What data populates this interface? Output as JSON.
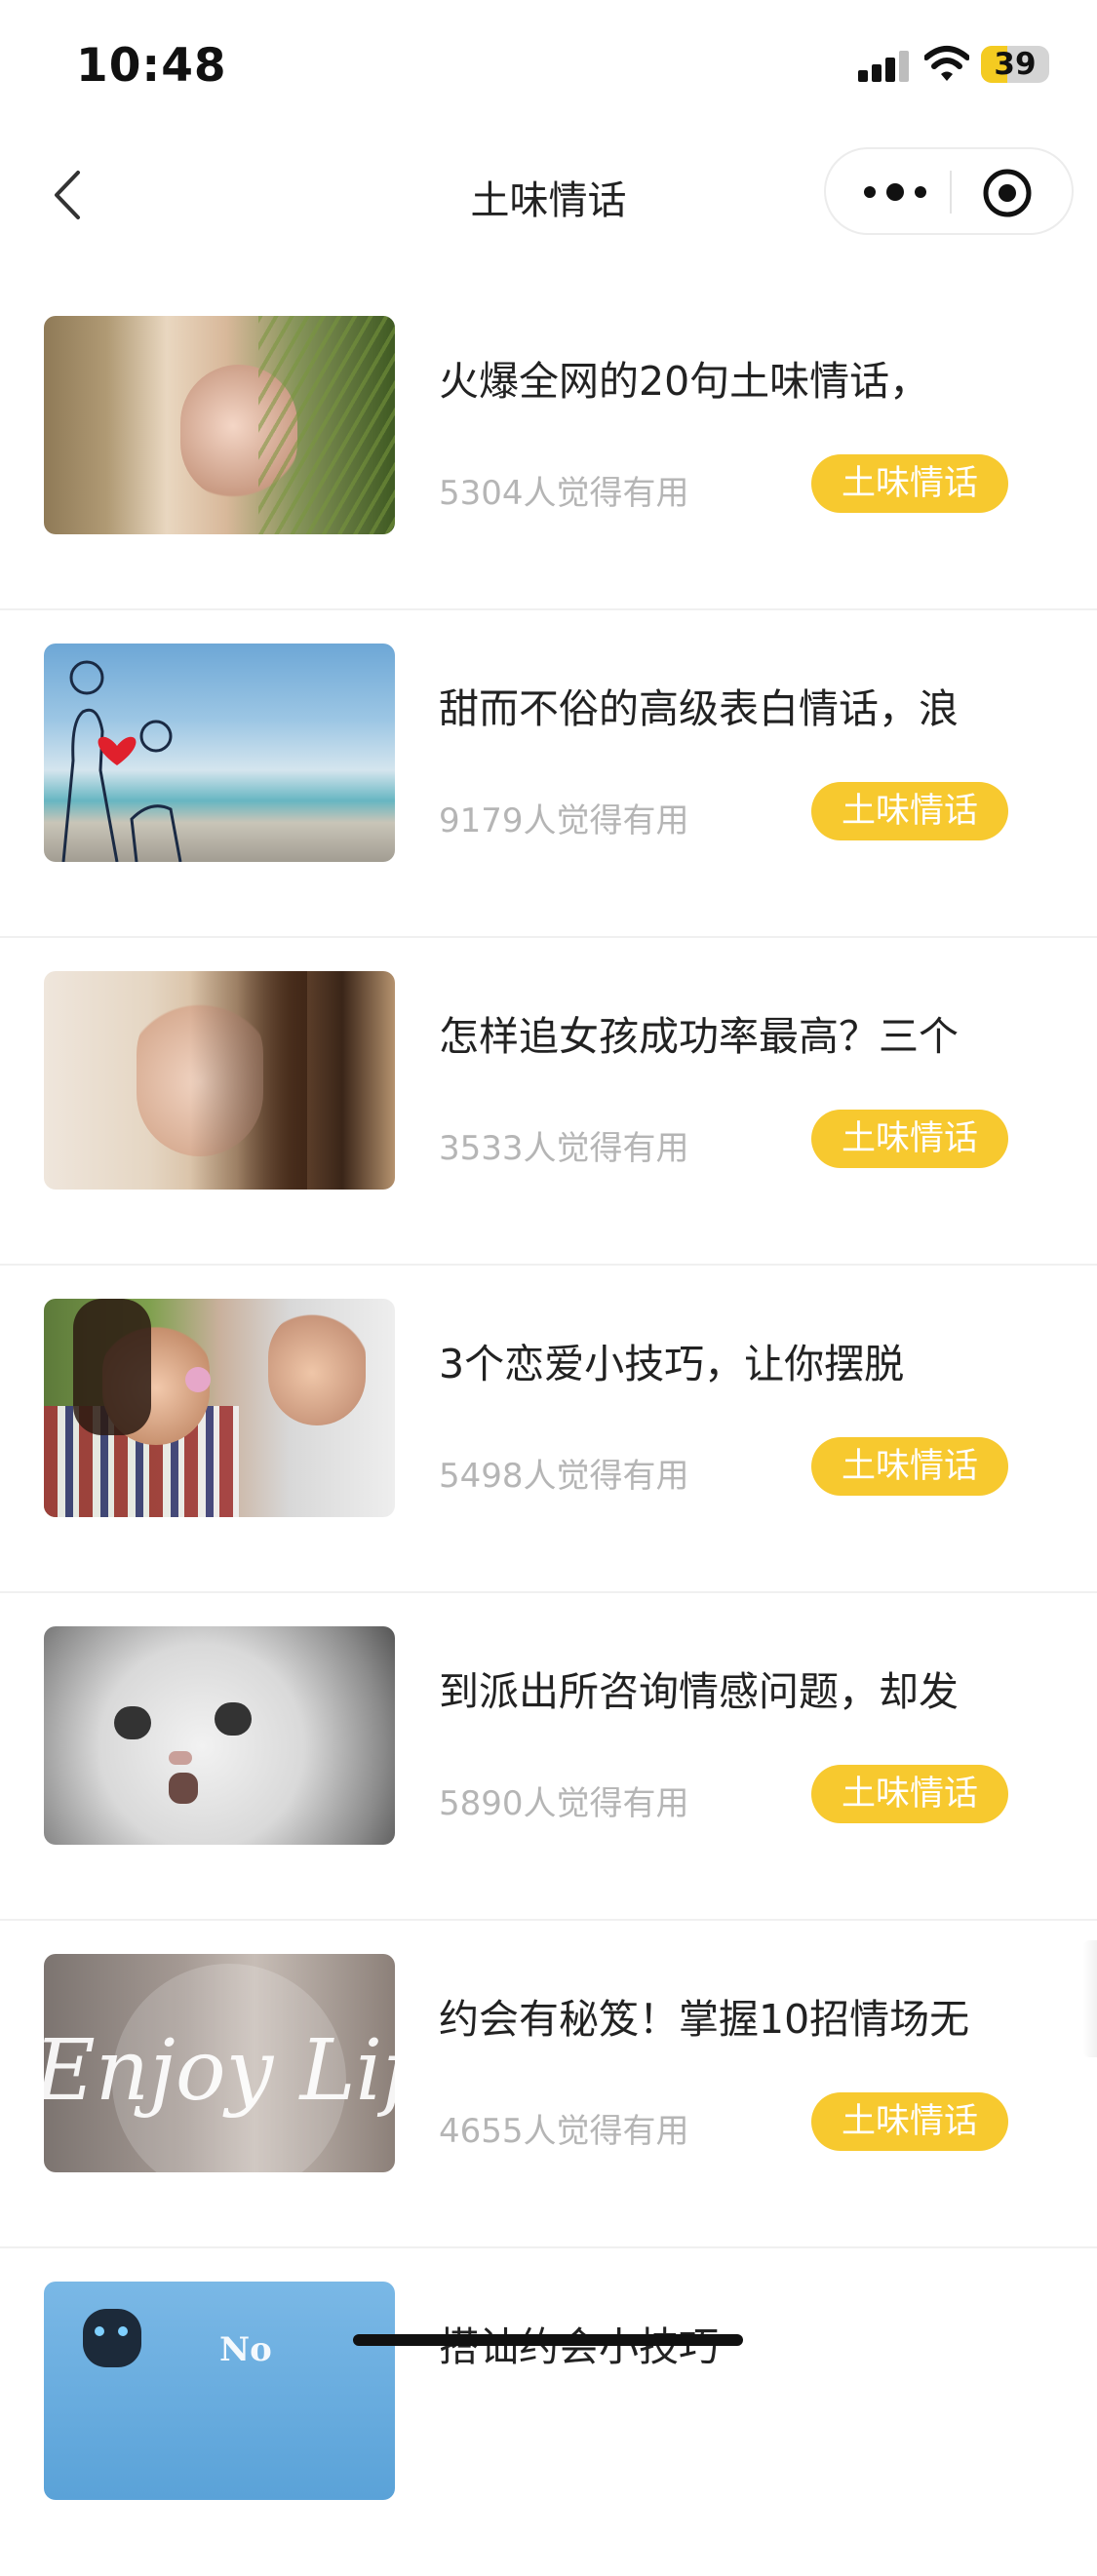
{
  "status": {
    "time": "10:48",
    "battery": "39",
    "battery_level": 0.39
  },
  "nav": {
    "title": "土味情话",
    "back_icon": "chevron-left-icon",
    "more_icon": "more-dots-icon",
    "close_icon": "target-circle-icon"
  },
  "items": [
    {
      "title": "火爆全网的20句土味情话，",
      "count": "5304人觉得有用",
      "tag": "土味情话",
      "image": "girl-with-fern-photo"
    },
    {
      "title": "甜而不俗的高级表白情话，浪",
      "count": "9179人觉得有用",
      "tag": "土味情话",
      "image": "proposal-silhouette-beach"
    },
    {
      "title": "怎样追女孩成功率最高？三个",
      "count": "3533人觉得有用",
      "tag": "土味情话",
      "image": "girl-portrait-photo"
    },
    {
      "title": "3个恋爱小技巧，让你摆脱",
      "count": "5498人觉得有用",
      "tag": "土味情话",
      "image": "couple-with-flower-photo"
    },
    {
      "title": "到派出所咨询情感问题，却发",
      "count": "5890人觉得有用",
      "tag": "土味情话",
      "image": "white-cat-photo"
    },
    {
      "title": "约会有秘笈！掌握10招情场无",
      "count": "4655人觉得有用",
      "tag": "土味情话",
      "image": "enjoy-life-photo",
      "image_text": "Enjoy Lif"
    },
    {
      "title": "搭讪约会小技巧",
      "count": "",
      "tag": "",
      "image": "robot-no-photo",
      "image_text": "No"
    }
  ]
}
